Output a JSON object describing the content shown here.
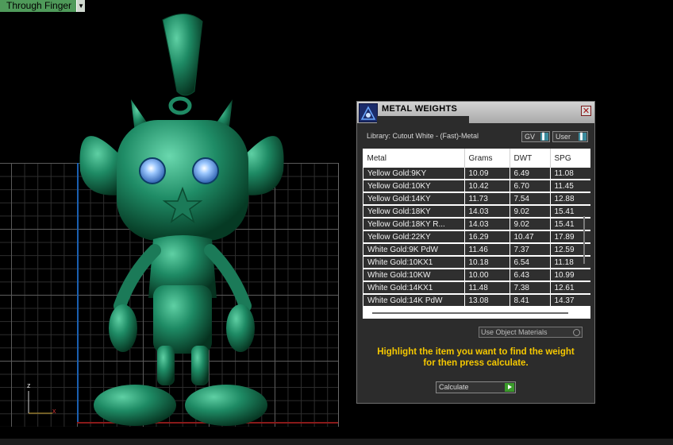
{
  "viewport": {
    "view_label": "Through Finger",
    "axis_z": "z",
    "axis_x": "x"
  },
  "panel": {
    "title": "METAL WEIGHTS",
    "close_glyph": "✕",
    "library_label": "Library: Cutout White - (Fast)-Metal",
    "gv_select": "GV",
    "user_select": "User",
    "columns": [
      "Metal",
      "Grams",
      "DWT",
      "SPG"
    ],
    "rows": [
      [
        "Yellow Gold:9KY",
        "10.09",
        "6.49",
        "11.08"
      ],
      [
        "Yellow Gold:10KY",
        "10.42",
        "6.70",
        "11.45"
      ],
      [
        "Yellow Gold:14KY",
        "11.73",
        "7.54",
        "12.88"
      ],
      [
        "Yellow Gold:18KY",
        "14.03",
        "9.02",
        "15.41"
      ],
      [
        "Yellow Gold:18KY R...",
        "14.03",
        "9.02",
        "15.41"
      ],
      [
        "Yellow Gold:22KY",
        "16.29",
        "10.47",
        "17.89"
      ],
      [
        "White Gold:9K PdW",
        "11.46",
        "7.37",
        "12.59"
      ],
      [
        "White Gold:10KX1",
        "10.18",
        "6.54",
        "11.18"
      ],
      [
        "White Gold:10KW",
        "10.00",
        "6.43",
        "10.99"
      ],
      [
        "White Gold:14KX1",
        "11.48",
        "7.38",
        "12.61"
      ],
      [
        "White Gold:14K PdW",
        "13.08",
        "8.41",
        "14.37"
      ]
    ],
    "use_object_materials": "Use Object Materials",
    "instruction_line1": "Highlight the item you want to find the weight",
    "instruction_line2": "for then press calculate.",
    "calculate_label": "Calculate"
  },
  "colors": {
    "model": "#1e8a64",
    "instruction": "#f5c800",
    "view_label_bg": "#4f9a5a",
    "calculate_go": "#3a9a2a"
  }
}
